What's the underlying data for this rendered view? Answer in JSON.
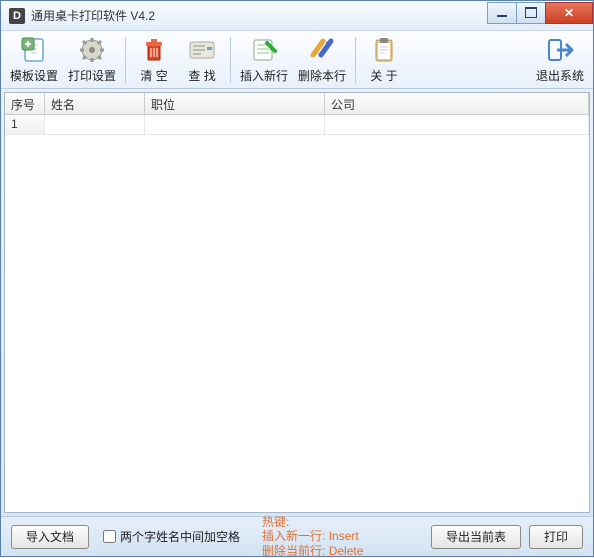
{
  "window": {
    "title": "通用桌卡打印软件    V4.2"
  },
  "toolbar": {
    "template": "模板设置",
    "print_setup": "打印设置",
    "clear": "清    空",
    "find": "查    找",
    "insert": "插入新行",
    "delete": "删除本行",
    "about": "关    于",
    "exit": "退出系统"
  },
  "grid": {
    "headers": {
      "seq": "序号",
      "name": "姓名",
      "position": "职位",
      "company": "公司"
    },
    "rows": [
      {
        "seq": "1",
        "name": "",
        "position": "",
        "company": ""
      }
    ]
  },
  "footer": {
    "import": "导入文档",
    "space_label": "两个字姓名中间加空格",
    "space_checked": false,
    "hotkey_title": "热键:",
    "hotkey_insert_cn": "插入新一行: ",
    "hotkey_insert_en": "Insert",
    "hotkey_delete_cn": "删除当前行: ",
    "hotkey_delete_en": "Delete",
    "export": "导出当前表",
    "print": "打印"
  }
}
